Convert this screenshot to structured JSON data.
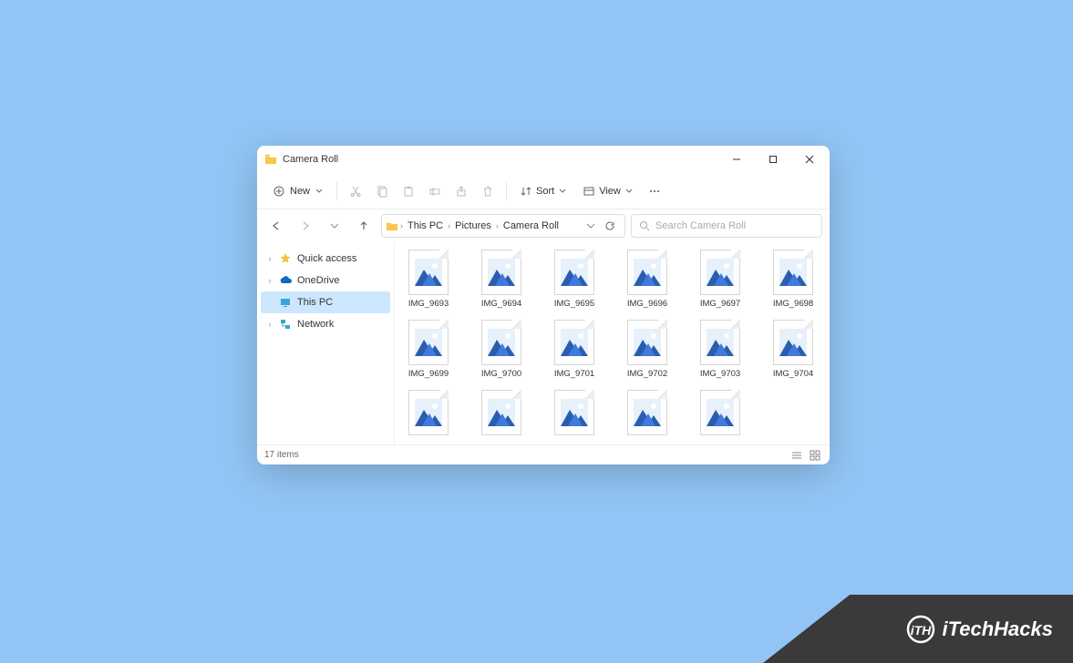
{
  "titlebar": {
    "title": "Camera Roll"
  },
  "toolbar": {
    "new_label": "New",
    "sort_label": "Sort",
    "view_label": "View"
  },
  "breadcrumbs": {
    "b0": "This PC",
    "b1": "Pictures",
    "b2": "Camera Roll"
  },
  "search": {
    "placeholder": "Search Camera Roll"
  },
  "sidebar": {
    "quick_access": "Quick access",
    "onedrive": "OneDrive",
    "this_pc": "This PC",
    "network": "Network"
  },
  "files": [
    "IMG_9693",
    "IMG_9694",
    "IMG_9695",
    "IMG_9696",
    "IMG_9697",
    "IMG_9698",
    "IMG_9699",
    "IMG_9700",
    "IMG_9701",
    "IMG_9702",
    "IMG_9703",
    "IMG_9704",
    "",
    "",
    "",
    "",
    ""
  ],
  "status": {
    "count": "17 items"
  },
  "banner": {
    "brand": "iTechHacks"
  }
}
